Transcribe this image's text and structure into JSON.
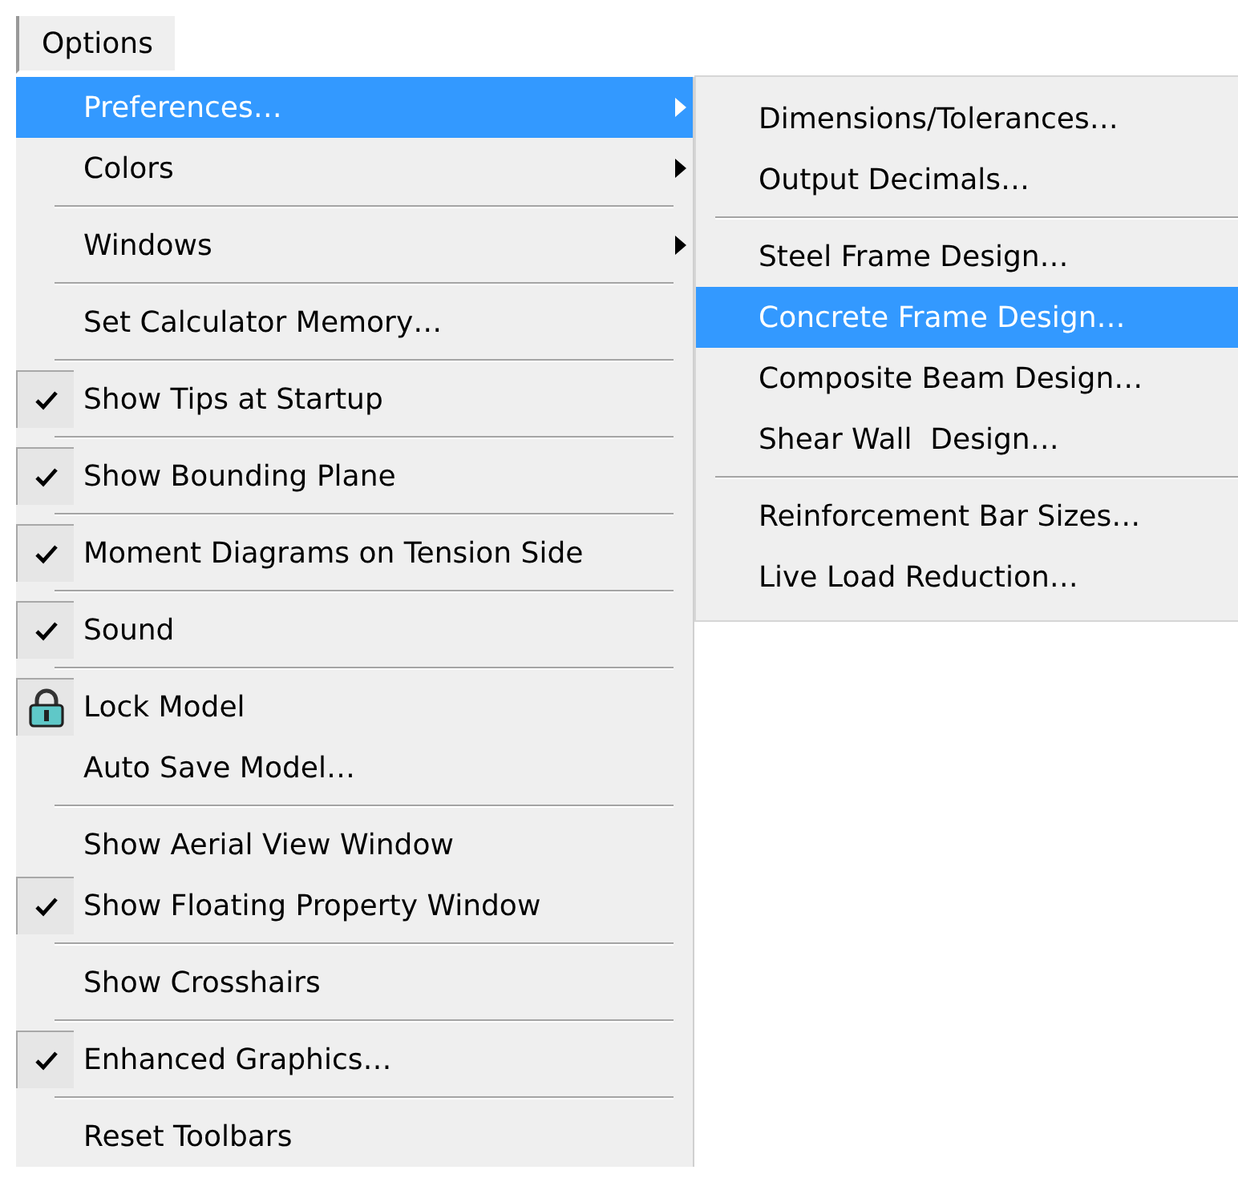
{
  "menu_bar": {
    "title": "Options"
  },
  "menu": {
    "items": [
      {
        "kind": "submenu",
        "label": "Preferences…",
        "selected": true,
        "submenu": {
          "items": [
            {
              "kind": "command",
              "label": "Dimensions/Tolerances…",
              "selected": false
            },
            {
              "kind": "command",
              "label": "Output Decimals…",
              "selected": false
            },
            {
              "kind": "separator"
            },
            {
              "kind": "command",
              "label": "Steel Frame Design…",
              "selected": false
            },
            {
              "kind": "command",
              "label": "Concrete Frame Design…",
              "selected": true
            },
            {
              "kind": "command",
              "label": "Composite Beam Design…",
              "selected": false
            },
            {
              "kind": "command",
              "label": "Shear Wall  Design…",
              "selected": false
            },
            {
              "kind": "separator"
            },
            {
              "kind": "command",
              "label": "Reinforcement Bar Sizes…",
              "selected": false
            },
            {
              "kind": "command",
              "label": "Live Load Reduction…",
              "selected": false
            }
          ]
        }
      },
      {
        "kind": "submenu",
        "label": "Colors",
        "selected": false
      },
      {
        "kind": "separator"
      },
      {
        "kind": "submenu",
        "label": "Windows",
        "selected": false
      },
      {
        "kind": "separator"
      },
      {
        "kind": "command",
        "label": "Set Calculator Memory…",
        "selected": false
      },
      {
        "kind": "separator"
      },
      {
        "kind": "check",
        "label": "Show Tips at Startup",
        "checked": true,
        "selected": false
      },
      {
        "kind": "separator"
      },
      {
        "kind": "check",
        "label": "Show Bounding Plane",
        "checked": true,
        "selected": false
      },
      {
        "kind": "separator"
      },
      {
        "kind": "check",
        "label": "Moment Diagrams on Tension Side",
        "checked": true,
        "selected": false
      },
      {
        "kind": "separator"
      },
      {
        "kind": "check",
        "label": "Sound",
        "checked": true,
        "selected": false
      },
      {
        "kind": "separator"
      },
      {
        "kind": "lock",
        "label": "Lock Model",
        "selected": false
      },
      {
        "kind": "command",
        "label": "Auto Save Model…",
        "selected": false
      },
      {
        "kind": "separator"
      },
      {
        "kind": "check",
        "label": "Show Aerial View Window",
        "checked": false,
        "selected": false
      },
      {
        "kind": "check",
        "label": "Show Floating Property Window",
        "checked": true,
        "selected": false
      },
      {
        "kind": "separator"
      },
      {
        "kind": "check",
        "label": "Show Crosshairs",
        "checked": false,
        "selected": false
      },
      {
        "kind": "separator"
      },
      {
        "kind": "check",
        "label": "Enhanced Graphics…",
        "checked": true,
        "selected": false
      },
      {
        "kind": "separator"
      },
      {
        "kind": "command",
        "label": "Reset Toolbars",
        "selected": false
      }
    ]
  }
}
